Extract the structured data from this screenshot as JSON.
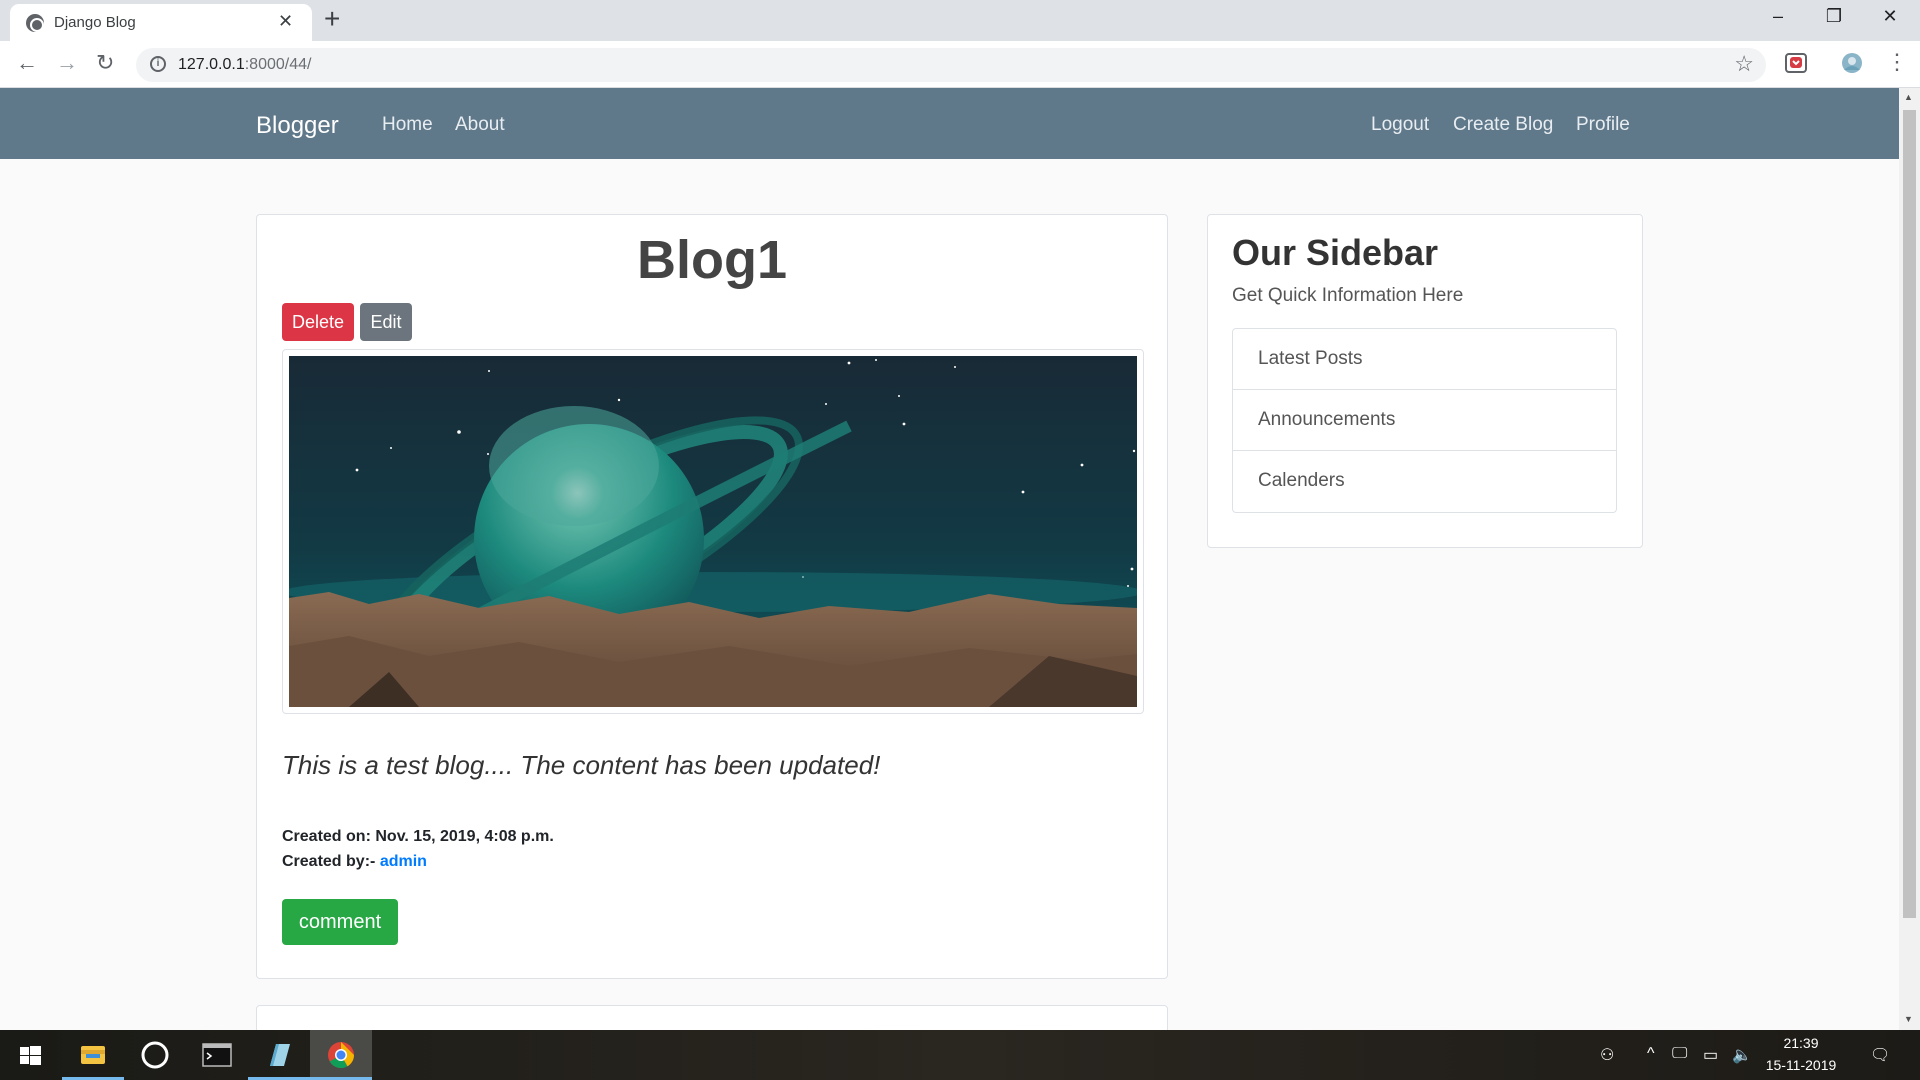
{
  "browser": {
    "tab_title": "Django Blog",
    "url_host": "127.0.0.1",
    "url_rest": ":8000/44/"
  },
  "navbar": {
    "brand": "Blogger",
    "left_links": [
      "Home",
      "About"
    ],
    "right_links": [
      "Logout",
      "Create Blog",
      "Profile"
    ]
  },
  "post": {
    "title": "Blog1",
    "delete_label": "Delete",
    "edit_label": "Edit",
    "content": "This is a test blog.... The content has been updated!",
    "created_on_label": "Created on:",
    "created_on": "Nov. 15, 2019, 4:08 p.m.",
    "created_by_label": "Created by:-",
    "author": "admin",
    "comment_label": "comment"
  },
  "sidebar": {
    "title": "Our Sidebar",
    "subtitle": "Get Quick Information Here",
    "items": [
      "Latest Posts",
      "Announcements",
      "Calenders"
    ]
  },
  "taskbar": {
    "time": "21:39",
    "date": "15-11-2019"
  },
  "colors": {
    "navbar": "#5f788a",
    "danger": "#dc3545",
    "secondary": "#6c757d",
    "success": "#28a745",
    "link": "#007bff"
  }
}
